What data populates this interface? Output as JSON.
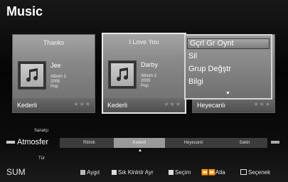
{
  "header": {
    "title": "Music"
  },
  "cards": [
    {
      "title": "Thanks",
      "artist": "Jee",
      "album": "Album 1",
      "year": "2005",
      "genre": "Pop",
      "mood": "Kederli",
      "stars": "★★★"
    },
    {
      "title": "I Love You",
      "artist": "Darby",
      "album": "Album 2",
      "year": "2005",
      "genre": "Pop",
      "mood": "Kederli",
      "stars": "★★★"
    },
    {
      "mood": "Heyecanlı",
      "stars": "★★★"
    }
  ],
  "popup_menu": {
    "items": [
      "Gçrl Gr Oynt",
      "Sil",
      "Grup Değştr",
      "Bilgi"
    ],
    "selected_index": 0,
    "more_arrow": "▼"
  },
  "mood_bar": {
    "label_above": "Sanatçı",
    "current": "Atmosfer",
    "label_below": "Tür",
    "segments": [
      "Ritmik",
      "Kederli",
      "Heyecanlı",
      "Sakin"
    ],
    "active_segment": "Kederli",
    "marker": "▲"
  },
  "footer": {
    "mode": "SUM",
    "hints": [
      {
        "key_color": "#b9b9b9",
        "label": "Aygıt"
      },
      {
        "key_color": "#dddddd",
        "label": "Sık Klnlnlr Ayr"
      },
      {
        "key_color": "#dddddd",
        "label": "Seçim"
      },
      {
        "icon": "⏪⏩",
        "label": "Atla"
      },
      {
        "icon": "tools-icon",
        "label": "Seçenek"
      }
    ]
  }
}
